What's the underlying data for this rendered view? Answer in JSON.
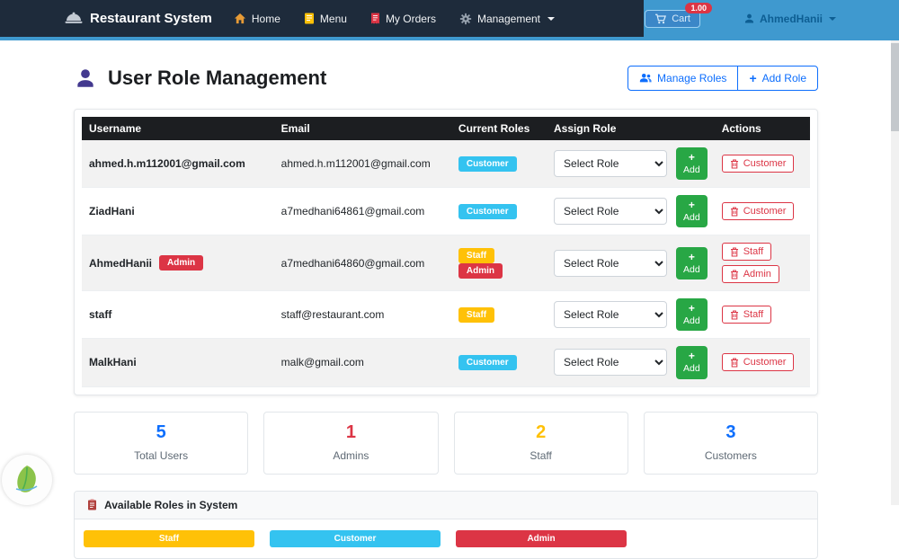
{
  "navbar": {
    "brand": "Restaurant System",
    "items": [
      {
        "label": "Home"
      },
      {
        "label": "Menu"
      },
      {
        "label": "My Orders"
      },
      {
        "label": "Management"
      }
    ],
    "cart_label": "Cart",
    "cart_badge": "1.00",
    "user_name": "AhmedHanii"
  },
  "page": {
    "title": "User Role Management",
    "manage_roles_label": "Manage Roles",
    "add_role_plus": "+",
    "add_role_label": "Add Role"
  },
  "table": {
    "headers": [
      "Username",
      "Email",
      "Current Roles",
      "Assign Role",
      "Actions"
    ],
    "add_button": {
      "plus": "+",
      "label": "Add"
    },
    "rows": [
      {
        "username": "ahmed.h.m112001@gmail.com",
        "email": "ahmed.h.m112001@gmail.com",
        "roles": [
          {
            "name": "Customer"
          }
        ],
        "select_placeholder": "Select Role",
        "actions": [
          {
            "name": "Customer"
          }
        ]
      },
      {
        "username": "ZiadHani",
        "email": "a7medhani64861@gmail.com",
        "roles": [
          {
            "name": "Customer"
          }
        ],
        "select_placeholder": "Select Role",
        "actions": [
          {
            "name": "Customer"
          }
        ]
      },
      {
        "username": "AhmedHanii",
        "name_badge": "Admin",
        "email": "a7medhani64860@gmail.com",
        "roles": [
          {
            "name": "Staff"
          },
          {
            "name": "Admin"
          }
        ],
        "select_placeholder": "Select Role",
        "actions": [
          {
            "name": "Staff"
          },
          {
            "name": "Admin"
          }
        ]
      },
      {
        "username": "staff",
        "email": "staff@restaurant.com",
        "roles": [
          {
            "name": "Staff"
          }
        ],
        "select_placeholder": "Select Role",
        "actions": [
          {
            "name": "Staff"
          }
        ]
      },
      {
        "username": "MalkHani",
        "email": "malk@gmail.com",
        "roles": [
          {
            "name": "Customer"
          }
        ],
        "select_placeholder": "Select Role",
        "actions": [
          {
            "name": "Customer"
          }
        ]
      }
    ]
  },
  "stats": [
    {
      "value": "5",
      "label": "Total Users",
      "color": "#0d6efd"
    },
    {
      "value": "1",
      "label": "Admins",
      "color": "#dc3545"
    },
    {
      "value": "2",
      "label": "Staff",
      "color": "#ffc107"
    },
    {
      "value": "3",
      "label": "Customers",
      "color": "#0d6efd"
    }
  ],
  "roles_panel": {
    "title": "Available Roles in System",
    "roles": [
      {
        "label": "Staff",
        "color": "#ffc107"
      },
      {
        "label": "Customer",
        "color": "#34c3f0"
      },
      {
        "label": "Admin",
        "color": "#dc3545"
      }
    ]
  },
  "colors": {
    "navbar_dark": "#1e2b3b",
    "header_accent": "#3f99cf",
    "primary": "#0d6efd",
    "success": "#28a745",
    "danger": "#dc3545",
    "warning": "#ffc107",
    "customer_badge": "#34c3f0",
    "table_header": "#1c1e21"
  }
}
